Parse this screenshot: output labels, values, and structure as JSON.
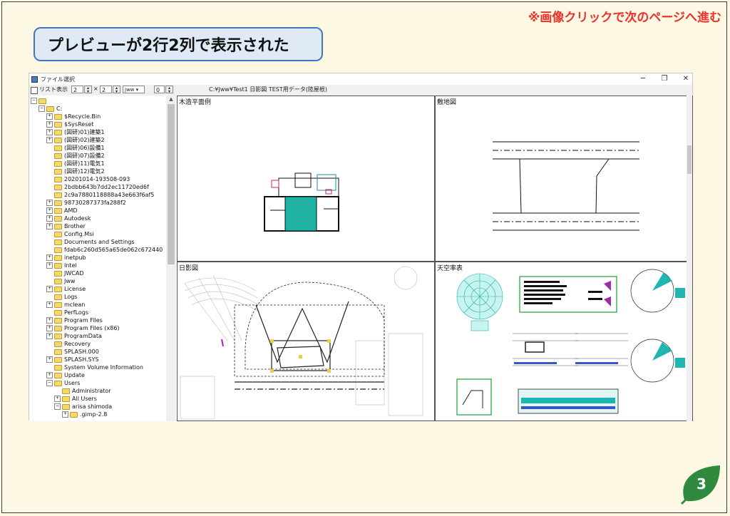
{
  "top_note": "※画像クリックで次のページへ進む",
  "banner_text": "プレビューが2行2列で表示された",
  "window": {
    "title": "ファイル選択",
    "minimize": "─",
    "restore": "❐",
    "close": "✕"
  },
  "toolbar": {
    "list_view_label": "リスト表示",
    "rows": "2",
    "times": "×",
    "cols": "2",
    "filetype": "jww",
    "zero": "0",
    "path": "C:¥Jww¥Test1  日影図  TEST用データ(陸屋根)"
  },
  "tree": [
    {
      "label": "",
      "level": 0,
      "exp": "−"
    },
    {
      "label": "C:",
      "level": 1,
      "exp": "−"
    },
    {
      "label": "$Recycle.Bin",
      "level": 2,
      "exp": "+"
    },
    {
      "label": "$SysReset",
      "level": 2,
      "exp": "+"
    },
    {
      "label": "(図研)01)建築1",
      "level": 2,
      "exp": "+"
    },
    {
      "label": "(図研)02)建築2",
      "level": 2,
      "exp": "+"
    },
    {
      "label": "(図研)06)設備1",
      "level": 2,
      "exp": ""
    },
    {
      "label": "(図研)07)設備2",
      "level": 2,
      "exp": ""
    },
    {
      "label": "(図研)11)電気1",
      "level": 2,
      "exp": ""
    },
    {
      "label": "(図研)12)電気2",
      "level": 2,
      "exp": ""
    },
    {
      "label": "20201014-193508-093",
      "level": 2,
      "exp": ""
    },
    {
      "label": "2bdbb643b7dd2ec11720ed6f",
      "level": 2,
      "exp": ""
    },
    {
      "label": "2c9a7880118888a43e663f6af5",
      "level": 2,
      "exp": ""
    },
    {
      "label": "98730287373fa288f2",
      "level": 2,
      "exp": "+"
    },
    {
      "label": "AMD",
      "level": 2,
      "exp": "+"
    },
    {
      "label": "Autodesk",
      "level": 2,
      "exp": "+"
    },
    {
      "label": "Brother",
      "level": 2,
      "exp": "+"
    },
    {
      "label": "Config.Msi",
      "level": 2,
      "exp": ""
    },
    {
      "label": "Documents and Settings",
      "level": 2,
      "exp": ""
    },
    {
      "label": "fdab6c260d565a65de062c672440",
      "level": 2,
      "exp": ""
    },
    {
      "label": "inetpub",
      "level": 2,
      "exp": "+"
    },
    {
      "label": "Intel",
      "level": 2,
      "exp": "+"
    },
    {
      "label": "JWCAD",
      "level": 2,
      "exp": ""
    },
    {
      "label": "Jww",
      "level": 2,
      "exp": ""
    },
    {
      "label": "License",
      "level": 2,
      "exp": "+"
    },
    {
      "label": "Logs",
      "level": 2,
      "exp": ""
    },
    {
      "label": "mclean",
      "level": 2,
      "exp": "+"
    },
    {
      "label": "PerfLogs",
      "level": 2,
      "exp": ""
    },
    {
      "label": "Program Files",
      "level": 2,
      "exp": "+"
    },
    {
      "label": "Program Files (x86)",
      "level": 2,
      "exp": "+"
    },
    {
      "label": "ProgramData",
      "level": 2,
      "exp": "+"
    },
    {
      "label": "Recovery",
      "level": 2,
      "exp": ""
    },
    {
      "label": "SPLASH.000",
      "level": 2,
      "exp": ""
    },
    {
      "label": "SPLASH.SYS",
      "level": 2,
      "exp": "+"
    },
    {
      "label": "System Volume Information",
      "level": 2,
      "exp": ""
    },
    {
      "label": "Update",
      "level": 2,
      "exp": "+"
    },
    {
      "label": "Users",
      "level": 2,
      "exp": "−"
    },
    {
      "label": "Administrator",
      "level": 3,
      "exp": ""
    },
    {
      "label": "All Users",
      "level": 3,
      "exp": "+"
    },
    {
      "label": "arisa shimoda",
      "level": 3,
      "exp": "−"
    },
    {
      "label": ".gimp-2.8",
      "level": 4,
      "exp": "+"
    }
  ],
  "previews": {
    "tl": "木造平面例",
    "tr": "敷地図",
    "bl": "日影図",
    "br": "天空率表"
  },
  "page_number": "3",
  "colors": {
    "background": "#fdf8e4",
    "accent_red": "#e8322b",
    "banner_border": "#3f77c0",
    "banner_fill": "#dfeaf6",
    "badge_green": "#2f8a3e"
  }
}
